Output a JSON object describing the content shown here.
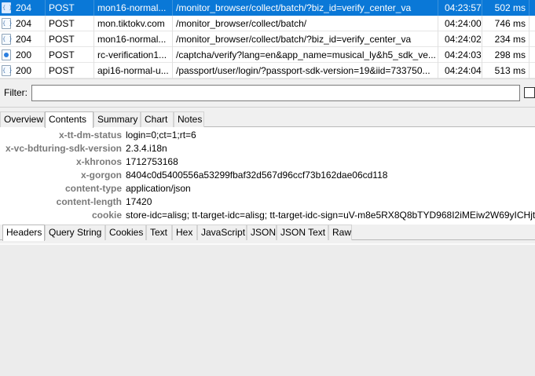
{
  "requests": [
    {
      "status": "204",
      "method": "POST",
      "host": "mon16-normal...",
      "url": "/monitor_browser/collect/batch/?biz_id=verify_center_va",
      "time": "04:23:57",
      "duration": "502 ms",
      "selected": true,
      "icon": "json-icon"
    },
    {
      "status": "204",
      "method": "POST",
      "host": "mon.tiktokv.com",
      "url": "/monitor_browser/collect/batch/",
      "time": "04:24:00",
      "duration": "746 ms",
      "selected": false,
      "icon": "json-icon"
    },
    {
      "status": "204",
      "method": "POST",
      "host": "mon16-normal...",
      "url": "/monitor_browser/collect/batch/?biz_id=verify_center_va",
      "time": "04:24:02",
      "duration": "234 ms",
      "selected": false,
      "icon": "json-icon"
    },
    {
      "status": "200",
      "method": "POST",
      "host": "rc-verification1...",
      "url": "/captcha/verify?lang=en&app_name=musical_ly&h5_sdk_ve...",
      "time": "04:24:03",
      "duration": "298 ms",
      "selected": false,
      "icon": "dot-icon"
    },
    {
      "status": "200",
      "method": "POST",
      "host": "api16-normal-u...",
      "url": "/passport/user/login/?passport-sdk-version=19&iid=733750...",
      "time": "04:24:04",
      "duration": "513 ms",
      "selected": false,
      "icon": "json-icon"
    }
  ],
  "filter": {
    "label": "Filter:",
    "value": ""
  },
  "main_tabs": [
    "Overview",
    "Contents",
    "Summary",
    "Chart",
    "Notes"
  ],
  "main_tab_active": "Contents",
  "headers": [
    {
      "key": "x-tt-dm-status",
      "value": "login=0;ct=1;rt=6"
    },
    {
      "key": "x-vc-bdturing-sdk-version",
      "value": "2.3.4.i18n"
    },
    {
      "key": "x-khronos",
      "value": "1712753168"
    },
    {
      "key": "x-gorgon",
      "value": "8404c0d5400556a53299fbaf32d567d96ccf73b162dae06cd118"
    },
    {
      "key": "content-type",
      "value": "application/json"
    },
    {
      "key": "content-length",
      "value": "17420"
    },
    {
      "key": "cookie",
      "value": "store-idc=alisg; tt-target-idc=alisg; tt-target-idc-sign=uV-m8e5RX8Q8bTYD968I2iMEiw2W69yICHjt"
    }
  ],
  "sub_tabs": [
    "Headers",
    "Query String",
    "Cookies",
    "Text",
    "Hex",
    "JavaScript",
    "JSON",
    "JSON Text",
    "Raw"
  ],
  "sub_tab_active": "Headers",
  "colors": {
    "selection": "#0a78d7"
  }
}
